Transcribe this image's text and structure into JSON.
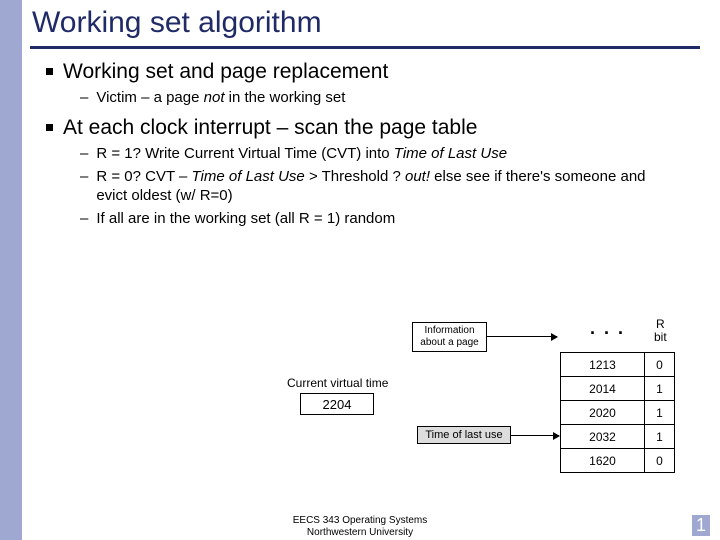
{
  "title": "Working set algorithm",
  "bullets": {
    "b1": "Working set and page replacement",
    "b1s1_pre": "Victim – a page ",
    "b1s1_em": "not",
    "b1s1_post": " in the working set",
    "b2": "At each clock interrupt – scan the page table",
    "b2s1_pre": "R = 1? Write Current Virtual Time (CVT) into ",
    "b2s1_em": "Time of Last Use",
    "b2s2_pre": "R = 0? CVT – ",
    "b2s2_em1": "Time of Last Use",
    "b2s2_mid": " > Threshold ? ",
    "b2s2_em2": "out!",
    "b2s2_post": " else see if there's someone and evict oldest (w/ R=0)",
    "b2s3": "If all are in the working set (all R = 1) random"
  },
  "diagram": {
    "info_l1": "Information",
    "info_l2": "about a page",
    "dots": ". . .",
    "rbit_l1": "R",
    "rbit_l2": "bit",
    "cvt_label": "Current virtual time",
    "cvt_value": "2204",
    "tolu_label": "Time of last use",
    "rows": [
      {
        "time": "1213",
        "r": "0"
      },
      {
        "time": "2014",
        "r": "1"
      },
      {
        "time": "2020",
        "r": "1"
      },
      {
        "time": "2032",
        "r": "1"
      },
      {
        "time": "1620",
        "r": "0"
      }
    ]
  },
  "footer": {
    "l1": "EECS 343 Operating Systems",
    "l2": "Northwestern University"
  },
  "pagenum": "1"
}
